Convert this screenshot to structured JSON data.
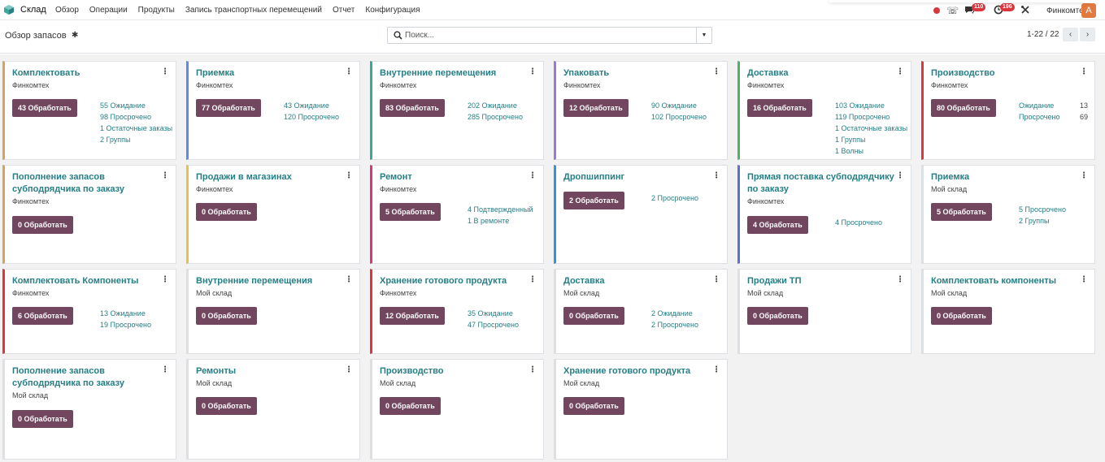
{
  "app": {
    "name": "Склад"
  },
  "menu": [
    "Обзор",
    "Операции",
    "Продукты",
    "Запись транспортных перемещений",
    "Отчет",
    "Конфигурация"
  ],
  "systray": {
    "messages_count": "110",
    "activities_count": "196",
    "company": "Финкомтех",
    "avatar_letter": "А"
  },
  "control": {
    "breadcrumb": "Обзор запасов",
    "search_placeholder": "Поиск...",
    "pager": "1-22 / 22"
  },
  "colors": {
    "primary": "#71465e",
    "link": "#257f85"
  },
  "cards": [
    {
      "title": "Комплектовать",
      "sub": "Финкомтех",
      "btn": "43 Обработать",
      "stats": [
        "55 Ожидание",
        "98 Просрочено",
        "1 Остаточные заказы",
        "2 Группы"
      ],
      "color": "#d9a35b"
    },
    {
      "title": "Приемка",
      "sub": "Финкомтех",
      "btn": "77 Обработать",
      "stats": [
        "43 Ожидание",
        "120 Просрочено"
      ],
      "color": "#5b8dd9"
    },
    {
      "title": "Внутренние перемещения",
      "sub": "Финкомтех",
      "btn": "83 Обработать",
      "stats": [
        "202 Ожидание",
        "285 Просрочено"
      ],
      "color": "#3aa89a"
    },
    {
      "title": "Упаковать",
      "sub": "Финкомтех",
      "btn": "12 Обработать",
      "stats": [
        "90 Ожидание",
        "102 Просрочено"
      ],
      "color": "#9b7ad4"
    },
    {
      "title": "Доставка",
      "sub": "Финкомтех",
      "btn": "16 Обработать",
      "stats": [
        "103 Ожидание",
        "119 Просрочено",
        "1 Остаточные заказы",
        "1 Группы",
        "1 Волны"
      ],
      "color": "#4db363"
    },
    {
      "title": "Производство",
      "sub": "Финкомтех",
      "btn": "80 Обработать",
      "stats": [
        "Ожидание",
        "Просрочено"
      ],
      "stats2": [
        "13",
        "69"
      ],
      "color": "#e0343f"
    },
    {
      "title": "Пополнение запасов субподрядчика по заказу",
      "sub": "Финкомтех",
      "btn": "0 Обработать",
      "stats": [],
      "color": "#d9a35b"
    },
    {
      "title": "Продажи в магазинах",
      "sub": "Финкомтех",
      "btn": "0 Обработать",
      "stats": [],
      "color": "#e6c24d"
    },
    {
      "title": "Ремонт",
      "sub": "Финкомтех",
      "btn": "5 Обработать",
      "stats": [
        "4 Подтвержденный",
        "1 В ремонте"
      ],
      "color": "#e0347a"
    },
    {
      "title": "Дропшиппинг",
      "sub": "",
      "btn": "2 Обработать",
      "stats": [
        "2 Просрочено"
      ],
      "color": "#3a8fd9"
    },
    {
      "title": "Прямая поставка субподрядчику по заказу",
      "sub": "Финкомтех",
      "btn": "4 Обработать",
      "stats": [
        "4 Просрочено"
      ],
      "color": "#5b72c9"
    },
    {
      "title": "Приемка",
      "sub": "Мой склад",
      "btn": "5 Обработать",
      "stats": [
        "5 Просрочено",
        "2 Группы"
      ],
      "color": "#dcdfe3"
    },
    {
      "title": "Комплектовать Компоненты",
      "sub": "Финкомтех",
      "btn": "6 Обработать",
      "stats": [
        "13 Ожидание",
        "19 Просрочено"
      ],
      "color": "#e0343f"
    },
    {
      "title": "Внутренние перемещения",
      "sub": "Мой склад",
      "btn": "0 Обработать",
      "stats": [],
      "color": "#dcdfe3"
    },
    {
      "title": "Хранение готового продукта",
      "sub": "Финкомтех",
      "btn": "12 Обработать",
      "stats": [
        "35 Ожидание",
        "47 Просрочено"
      ],
      "color": "#e0343f"
    },
    {
      "title": "Доставка",
      "sub": "Мой склад",
      "btn": "0 Обработать",
      "stats": [
        "2 Ожидание",
        "2 Просрочено"
      ],
      "color": "#dcdfe3"
    },
    {
      "title": "Продажи ТП",
      "sub": "Мой склад",
      "btn": "0 Обработать",
      "stats": [],
      "color": "#dcdfe3"
    },
    {
      "title": "Комплектовать компоненты",
      "sub": "Мой склад",
      "btn": "0 Обработать",
      "stats": [],
      "color": "#dcdfe3"
    },
    {
      "title": "Пополнение запасов субподрядчика по заказу",
      "sub": "Мой склад",
      "btn": "0 Обработать",
      "stats": [],
      "color": "#dcdfe3"
    },
    {
      "title": "Ремонты",
      "sub": "Мой склад",
      "btn": "0 Обработать",
      "stats": [],
      "color": "#dcdfe3"
    },
    {
      "title": "Производство",
      "sub": "Мой склад",
      "btn": "0 Обработать",
      "stats": [],
      "color": "#dcdfe3"
    },
    {
      "title": "Хранение готового продукта",
      "sub": "Мой склад",
      "btn": "0 Обработать",
      "stats": [],
      "color": "#dcdfe3"
    }
  ]
}
